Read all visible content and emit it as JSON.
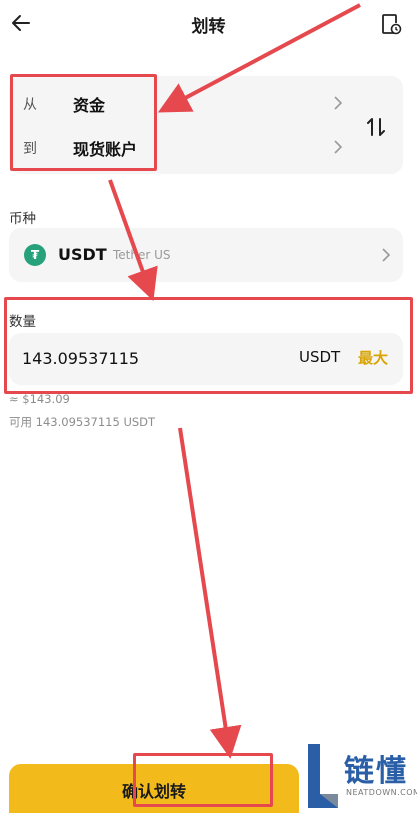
{
  "header": {
    "title": "划转"
  },
  "transfer": {
    "from_label": "从",
    "from_value": "资金",
    "to_label": "到",
    "to_value": "现货账户"
  },
  "coin": {
    "section_label": "币种",
    "symbol": "USDT",
    "name": "Tether US"
  },
  "amount": {
    "section_label": "数量",
    "value": "143.09537115",
    "unit": "USDT",
    "max_label": "最大",
    "fiat_estimate": "≈ $143.09",
    "available": "可用 143.09537115 USDT"
  },
  "confirm": {
    "label": "确认划转"
  },
  "watermark": {
    "title": "链懂",
    "subtitle": "NEATDOWN.COM"
  },
  "colors": {
    "accent": "#f3ba1b",
    "max": "#d9a405",
    "annotation": "#e5484d",
    "tether": "#26a17b"
  },
  "icons": [
    "back-arrow-icon",
    "history-icon",
    "chevron-right-icon",
    "swap-icon",
    "tether-icon"
  ]
}
